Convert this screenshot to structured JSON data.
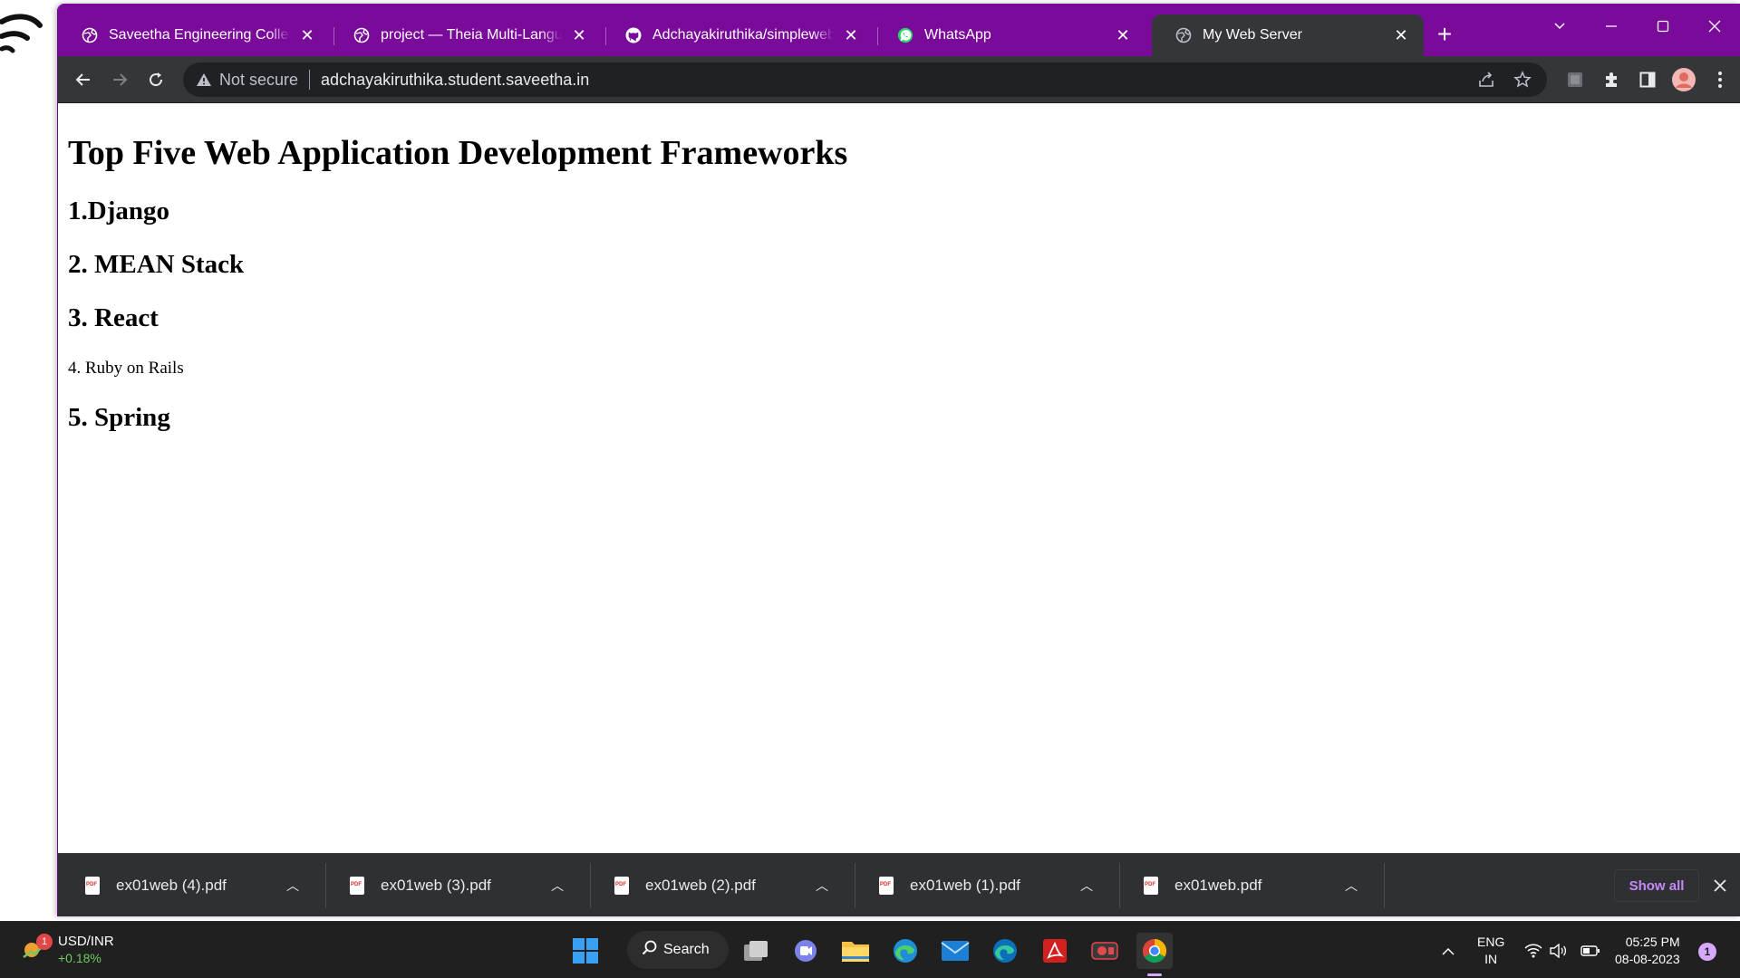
{
  "tabs": [
    {
      "title": "Saveetha Engineering College",
      "icon": "globe-icon",
      "active": false
    },
    {
      "title": "project — Theia Multi-Language",
      "icon": "globe-icon",
      "active": false
    },
    {
      "title": "Adchayakiruthika/simplewebserv",
      "icon": "github-icon",
      "active": false
    },
    {
      "title": "WhatsApp",
      "icon": "whatsapp-icon",
      "active": false
    },
    {
      "title": "My Web Server",
      "icon": "globe-icon",
      "active": true
    }
  ],
  "omnibox": {
    "security_label": "Not secure",
    "url": "adchayakiruthika.student.saveetha.in"
  },
  "page": {
    "heading": "Top Five Web Application Development Frameworks",
    "items": [
      {
        "text": "1.Django"
      },
      {
        "text": "2. MEAN Stack"
      },
      {
        "text": "3. React"
      },
      {
        "text": "4. Ruby on Rails"
      },
      {
        "text": "5. Spring"
      }
    ]
  },
  "downloads": {
    "items": [
      {
        "name": "ex01web (4).pdf"
      },
      {
        "name": "ex01web (3).pdf"
      },
      {
        "name": "ex01web (2).pdf"
      },
      {
        "name": "ex01web (1).pdf"
      },
      {
        "name": "ex01web.pdf"
      }
    ],
    "show_all_label": "Show all"
  },
  "taskbar": {
    "widget": {
      "badge": "1",
      "ticker": "USD/INR",
      "change": "+0.18%"
    },
    "search_label": "Search",
    "language": {
      "line1": "ENG",
      "line2": "IN"
    },
    "clock": {
      "time": "05:25 PM",
      "date": "08-08-2023"
    },
    "notification_count": "1"
  },
  "colors": {
    "tab_strip": "#7a0a9a",
    "toolbar": "#35363a",
    "taskbar": "#202020",
    "show_all_accent": "#c58af9"
  }
}
